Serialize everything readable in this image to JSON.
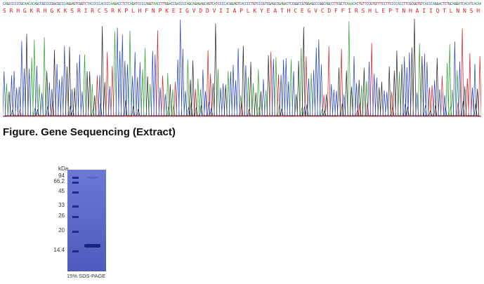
{
  "sequence": {
    "dna": "CAGCCCCCCGCAACACAGCCGCCCCGGCGCCCAGGAGTCGGTCTACCCCCACCCCAAGACCTCTCAGATCCCCAGGTAACCTTGGACCGACCCCAGCAGAGAGCAGTCATCCCCACGGAGTCACCCCTGTCCCGTCGAGCCGAGACTCCGGCCGTGGAGCCCGGCAGCCTTCGCTCAAACACTGTTCCGTGTTTCCTTCCCCACCTTCGCGGTGTCACCCAGGACTCTGCAGGATCACATCACAAAAAGCGAATCACCAAGCCTGTTCCACGCCACCGACGGGTTCCCCACCCCAGCCTGCAACCCCCAGCCTGGACACAGTGTTCGATTAGCCGACCAGTTCAAAGAGGAAACGAGTTCCCCAGCCCCCCGCTCGTCAAGTTCGCTGGGGTGATAGCTCCCAGAAGCGACGAGAGCAGCCCGATCGCGAGGGCCACGCAGAATCGTCACTCCGCGTCCACCCCAACCCCAGGCAGACCCAGCAGCCTGCAGCCACCCCACGTGCCGCGCGACCAAGGCGGGCAGTGGATCTGACAGCGGTTCCCATCACCCCTCCTGTCCTG",
    "amino_acids": "S R H G K R H G K K S R I R C S R K P L H F N P K E I G V D D V I I A P L K Y E A T H C E G V C D F F I R S H L E P T N H A I I Q T L N N S H D P G S T P P S C C V P T K L T P I"
  },
  "trace_colors": {
    "A": "#2ca02c",
    "C": "#1f3fbf",
    "G": "#222222",
    "T": "#d22020"
  },
  "figure": {
    "caption": "Figure. Gene Sequencing (Extract)"
  },
  "gel": {
    "kda_label": "kDa",
    "markers": [
      "94",
      "66.2",
      "45",
      "33",
      "26",
      "20",
      "14.4"
    ],
    "caption": "15% SDS-PAGE",
    "lane_color": "#5a67c8",
    "band_color": "#1a2380"
  }
}
